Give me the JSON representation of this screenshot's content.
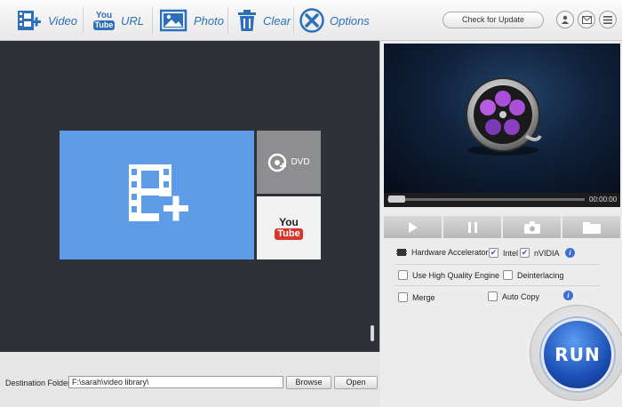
{
  "toolbar": {
    "video_label": "Video",
    "url_label": "URL",
    "photo_label": "Photo",
    "clear_label": "Clear",
    "options_label": "Options",
    "update_label": "Check for Update",
    "youtube_word_top": "You",
    "youtube_word_bottom": "Tube"
  },
  "source_tiles": {
    "dvd_label": "DVD",
    "youtube_top": "You",
    "youtube_bottom": "Tube"
  },
  "destination": {
    "label": "Destination Folder:",
    "path": "F:\\sarah\\video library\\",
    "browse_label": "Browse",
    "open_label": "Open"
  },
  "player": {
    "time": "00:00:00",
    "progress": 0
  },
  "options": {
    "hw_label": "Hardware Accelerator:",
    "intel_label": "Intel",
    "intel_checked": true,
    "nvidia_label": "nVIDIA",
    "nvidia_checked": true,
    "hq_label": "Use High Quality Engine",
    "hq_checked": false,
    "deint_label": "Deinterlacing",
    "deint_checked": false,
    "merge_label": "Merge",
    "merge_checked": false,
    "autocopy_label": "Auto Copy",
    "autocopy_checked": false,
    "info_glyph": "i"
  },
  "run_label": "RUN",
  "colors": {
    "accent": "#2d6fb8",
    "tile_blue": "#5e9ce8",
    "run_blue": "#1b4fb5"
  }
}
